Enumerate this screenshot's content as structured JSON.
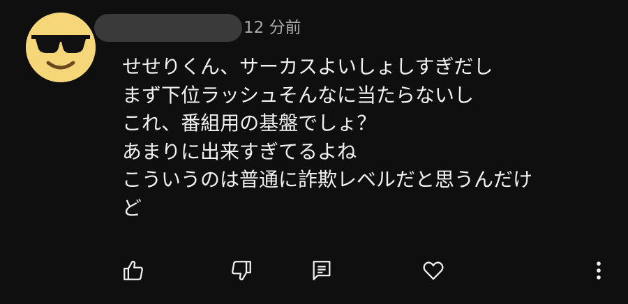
{
  "comment": {
    "author_avatar": "sunglasses-emoji",
    "author_name_redacted": true,
    "timestamp": "12 分前",
    "text_lines": [
      "せせりくん、サーカスよいしょしすぎだし",
      "まず下位ラッシュそんなに当たらないし",
      "これ、番組用の基盤でしょ？",
      "あまりに出来すぎてるよね",
      "こういうのは普通に詐欺レベルだと思うんだけ",
      "ど"
    ]
  },
  "actions": {
    "like_icon": "thumb-up-icon",
    "dislike_icon": "thumb-down-icon",
    "reply_icon": "comment-reply-icon",
    "heart_icon": "heart-icon",
    "more_icon": "more-vertical-icon"
  },
  "colors": {
    "background": "#0f0f0f",
    "text": "#f1f1f1",
    "secondary_text": "#aaaaaa",
    "avatar": "#f5d77a"
  }
}
